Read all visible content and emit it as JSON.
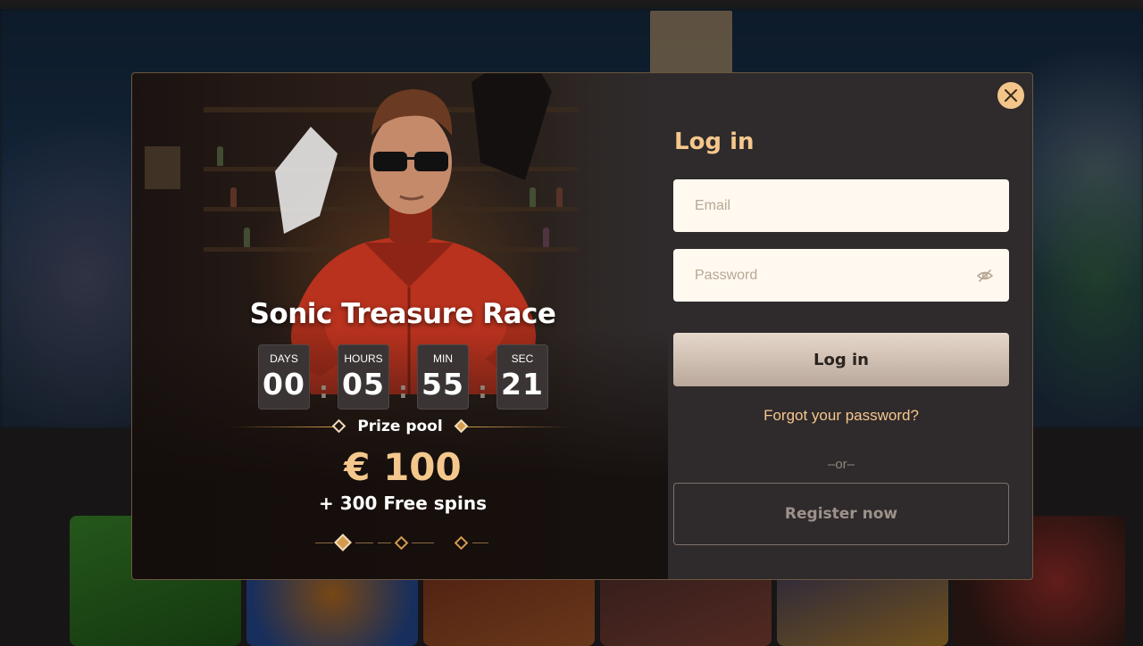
{
  "promo": {
    "title": "Sonic Treasure Race",
    "countdown": [
      {
        "label": "DAYS",
        "value": "00"
      },
      {
        "label": "HOURS",
        "value": "05"
      },
      {
        "label": "MIN",
        "value": "55"
      },
      {
        "label": "SEC",
        "value": "21"
      }
    ],
    "separator": ":",
    "prize_label": "Prize pool",
    "prize_amount": "€ 100",
    "prize_extra": "+ 300 Free spins"
  },
  "login": {
    "title": "Log in",
    "email_placeholder": "Email",
    "password_placeholder": "Password",
    "submit_label": "Log in",
    "forgot_label": "Forgot your password?",
    "or_label": "–or–",
    "register_label": "Register now"
  },
  "icons": {
    "close": "close-icon",
    "password_toggle": "eye-slash-icon"
  },
  "colors": {
    "accent": "#f4c78c",
    "modal_bg": "#2f2a2b",
    "field_bg": "#fff9f0"
  }
}
